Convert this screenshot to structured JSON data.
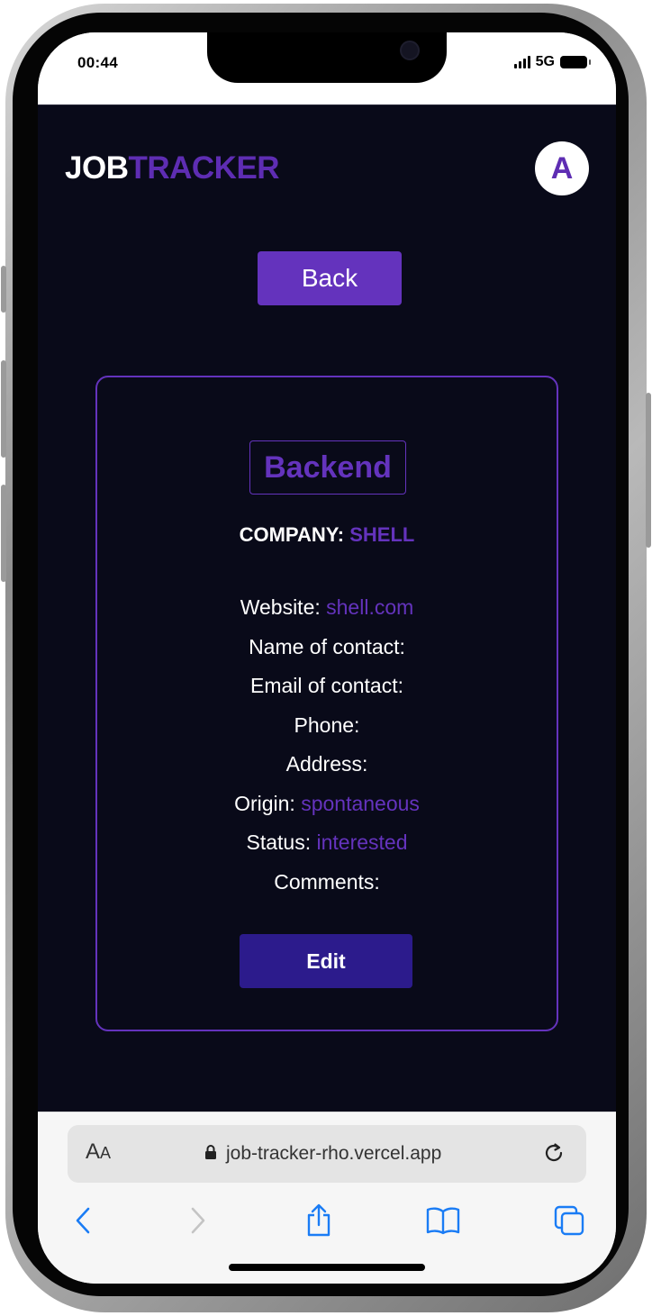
{
  "status_bar": {
    "time": "00:44",
    "network": "5G"
  },
  "header": {
    "logo_part1": "JOB",
    "logo_part2": "TRACKER",
    "avatar_letter": "A"
  },
  "actions": {
    "back_label": "Back",
    "edit_label": "Edit"
  },
  "job": {
    "title": "Backend",
    "company_label": "COMPANY:",
    "company_value": "SHELL",
    "fields": [
      {
        "label": "Website:",
        "value": "shell.com"
      },
      {
        "label": "Name of contact:",
        "value": ""
      },
      {
        "label": "Email of contact:",
        "value": ""
      },
      {
        "label": "Phone:",
        "value": ""
      },
      {
        "label": "Address:",
        "value": ""
      },
      {
        "label": "Origin:",
        "value": "spontaneous"
      },
      {
        "label": "Status:",
        "value": "interested"
      },
      {
        "label": "Comments:",
        "value": ""
      }
    ]
  },
  "browser": {
    "aa_label_big": "A",
    "aa_label_small": "A",
    "url": "job-tracker-rho.vercel.app",
    "icons": [
      "back-icon",
      "forward-icon",
      "share-icon",
      "bookmarks-icon",
      "tabs-icon",
      "reload-icon",
      "lock-icon"
    ]
  },
  "colors": {
    "accent": "#6433bd",
    "edit_button": "#2c1b8c",
    "background": "#090a19"
  }
}
